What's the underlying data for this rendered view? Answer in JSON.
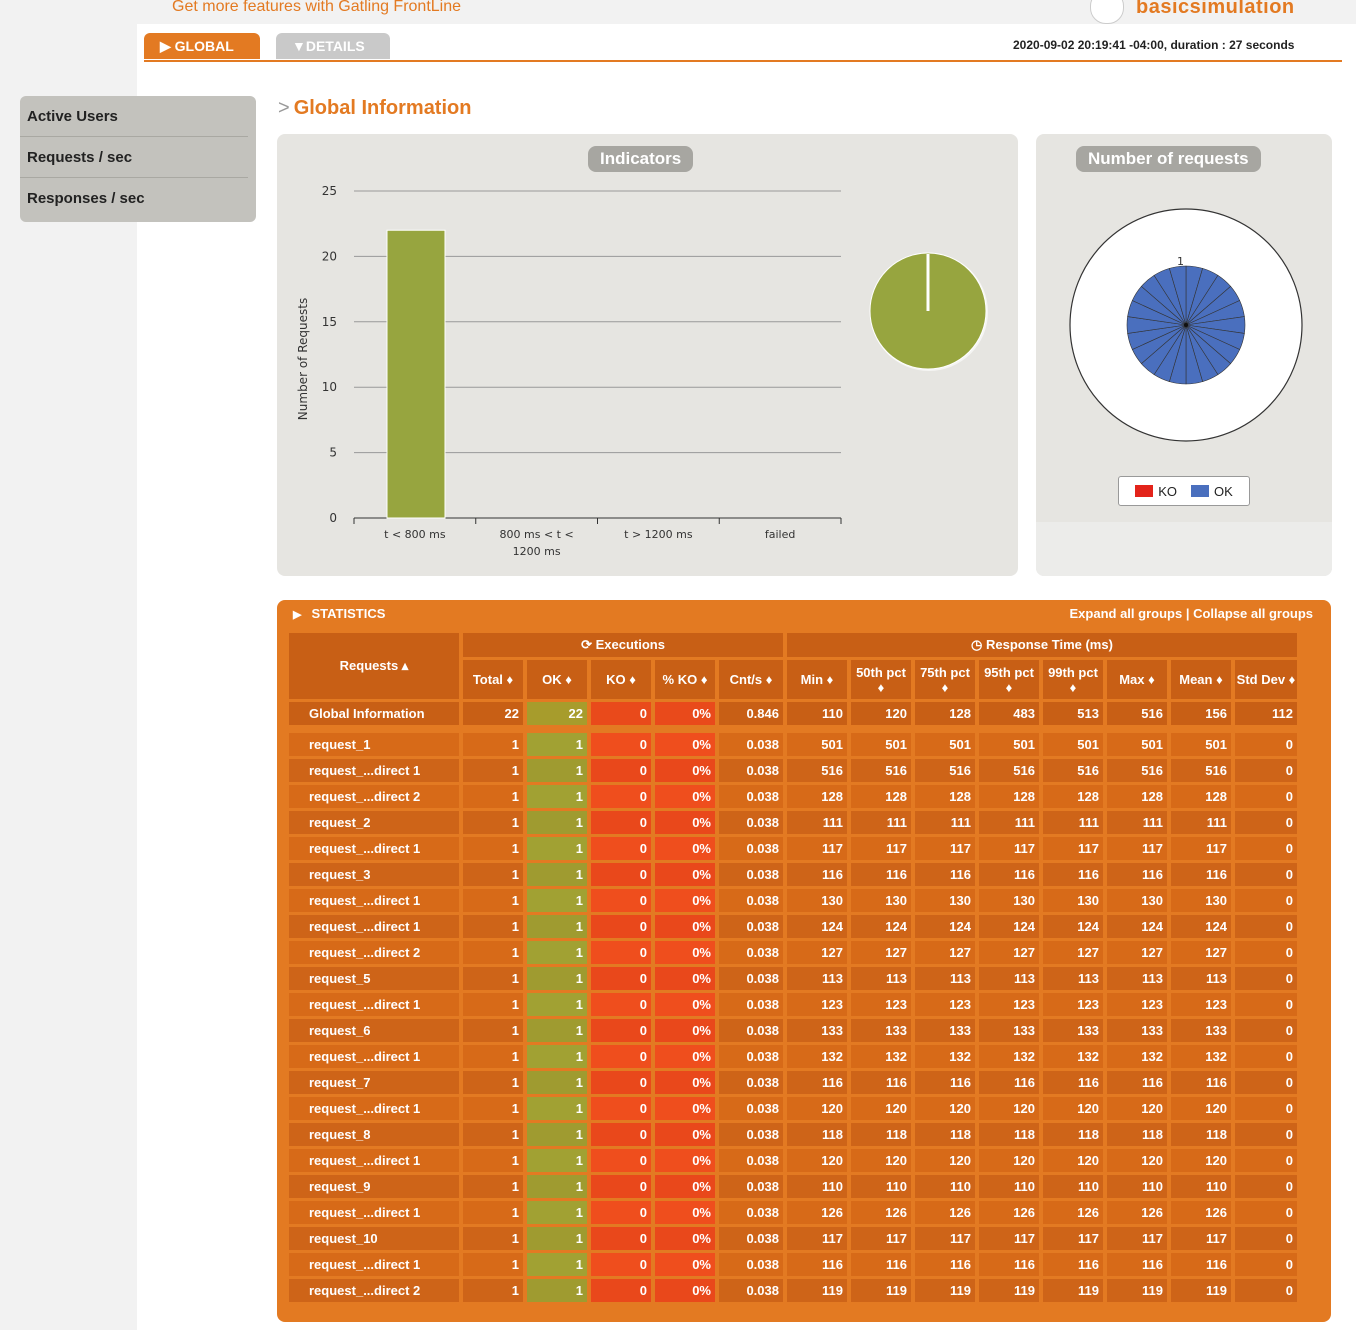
{
  "top": {
    "frontline_link": "Get more features with Gatling FrontLine",
    "simulation_name": "basicsimulation"
  },
  "tabs": {
    "global": "GLOBAL",
    "details": "DETAILS"
  },
  "run_info": "2020-09-02 20:19:41 -04:00, duration : 27 seconds",
  "sidebar": {
    "items": [
      {
        "label": "Active Users"
      },
      {
        "label": "Requests / sec"
      },
      {
        "label": "Responses / sec"
      }
    ]
  },
  "page_title": "Global Information",
  "chart_data": [
    {
      "type": "bar",
      "title": "Indicators",
      "ylabel": "Number of Requests",
      "categories": [
        "t < 800 ms",
        "800 ms < t < 1200 ms",
        "t > 1200 ms",
        "failed"
      ],
      "values": [
        22,
        0,
        0,
        0
      ],
      "ylim": [
        0,
        25
      ],
      "yticks": [
        0,
        5,
        10,
        15,
        20,
        25
      ],
      "color": "#97a53f"
    },
    {
      "type": "pie",
      "labels": [
        "t < 800 ms",
        "800 ms < t < 1200 ms",
        "t > 1200 ms",
        "failed"
      ],
      "values": [
        22,
        0,
        0,
        0
      ],
      "color": "#97a53f"
    },
    {
      "type": "pie",
      "title": "Number of requests",
      "slices": 22,
      "value_label": "1",
      "legend": [
        {
          "name": "KO",
          "color": "#e3231a"
        },
        {
          "name": "OK",
          "color": "#4a6fbe"
        }
      ]
    }
  ],
  "stats": {
    "title": "STATISTICS",
    "expand": "Expand all groups",
    "collapse": "Collapse all groups",
    "executions_label": "Executions",
    "response_time_label": "Response Time (ms)",
    "headers": [
      "Requests ▴",
      "Total ♦",
      "OK ♦",
      "KO ♦",
      "% KO ♦",
      "Cnt/s ♦",
      "Min ♦",
      "50th pct ♦",
      "75th pct ♦",
      "95th pct ♦",
      "99th pct ♦",
      "Max ♦",
      "Mean ♦",
      "Std Dev ♦"
    ],
    "global": [
      "Global Information",
      "22",
      "22",
      "0",
      "0%",
      "0.846",
      "110",
      "120",
      "128",
      "483",
      "513",
      "516",
      "156",
      "112"
    ],
    "rows": [
      [
        "request_1",
        "1",
        "1",
        "0",
        "0%",
        "0.038",
        "501",
        "501",
        "501",
        "501",
        "501",
        "501",
        "501",
        "0"
      ],
      [
        "request_...direct 1",
        "1",
        "1",
        "0",
        "0%",
        "0.038",
        "516",
        "516",
        "516",
        "516",
        "516",
        "516",
        "516",
        "0"
      ],
      [
        "request_...direct 2",
        "1",
        "1",
        "0",
        "0%",
        "0.038",
        "128",
        "128",
        "128",
        "128",
        "128",
        "128",
        "128",
        "0"
      ],
      [
        "request_2",
        "1",
        "1",
        "0",
        "0%",
        "0.038",
        "111",
        "111",
        "111",
        "111",
        "111",
        "111",
        "111",
        "0"
      ],
      [
        "request_...direct 1",
        "1",
        "1",
        "0",
        "0%",
        "0.038",
        "117",
        "117",
        "117",
        "117",
        "117",
        "117",
        "117",
        "0"
      ],
      [
        "request_3",
        "1",
        "1",
        "0",
        "0%",
        "0.038",
        "116",
        "116",
        "116",
        "116",
        "116",
        "116",
        "116",
        "0"
      ],
      [
        "request_...direct 1",
        "1",
        "1",
        "0",
        "0%",
        "0.038",
        "130",
        "130",
        "130",
        "130",
        "130",
        "130",
        "130",
        "0"
      ],
      [
        "request_...direct 1",
        "1",
        "1",
        "0",
        "0%",
        "0.038",
        "124",
        "124",
        "124",
        "124",
        "124",
        "124",
        "124",
        "0"
      ],
      [
        "request_...direct 2",
        "1",
        "1",
        "0",
        "0%",
        "0.038",
        "127",
        "127",
        "127",
        "127",
        "127",
        "127",
        "127",
        "0"
      ],
      [
        "request_5",
        "1",
        "1",
        "0",
        "0%",
        "0.038",
        "113",
        "113",
        "113",
        "113",
        "113",
        "113",
        "113",
        "0"
      ],
      [
        "request_...direct 1",
        "1",
        "1",
        "0",
        "0%",
        "0.038",
        "123",
        "123",
        "123",
        "123",
        "123",
        "123",
        "123",
        "0"
      ],
      [
        "request_6",
        "1",
        "1",
        "0",
        "0%",
        "0.038",
        "133",
        "133",
        "133",
        "133",
        "133",
        "133",
        "133",
        "0"
      ],
      [
        "request_...direct 1",
        "1",
        "1",
        "0",
        "0%",
        "0.038",
        "132",
        "132",
        "132",
        "132",
        "132",
        "132",
        "132",
        "0"
      ],
      [
        "request_7",
        "1",
        "1",
        "0",
        "0%",
        "0.038",
        "116",
        "116",
        "116",
        "116",
        "116",
        "116",
        "116",
        "0"
      ],
      [
        "request_...direct 1",
        "1",
        "1",
        "0",
        "0%",
        "0.038",
        "120",
        "120",
        "120",
        "120",
        "120",
        "120",
        "120",
        "0"
      ],
      [
        "request_8",
        "1",
        "1",
        "0",
        "0%",
        "0.038",
        "118",
        "118",
        "118",
        "118",
        "118",
        "118",
        "118",
        "0"
      ],
      [
        "request_...direct 1",
        "1",
        "1",
        "0",
        "0%",
        "0.038",
        "120",
        "120",
        "120",
        "120",
        "120",
        "120",
        "120",
        "0"
      ],
      [
        "request_9",
        "1",
        "1",
        "0",
        "0%",
        "0.038",
        "110",
        "110",
        "110",
        "110",
        "110",
        "110",
        "110",
        "0"
      ],
      [
        "request_...direct 1",
        "1",
        "1",
        "0",
        "0%",
        "0.038",
        "126",
        "126",
        "126",
        "126",
        "126",
        "126",
        "126",
        "0"
      ],
      [
        "request_10",
        "1",
        "1",
        "0",
        "0%",
        "0.038",
        "117",
        "117",
        "117",
        "117",
        "117",
        "117",
        "117",
        "0"
      ],
      [
        "request_...direct 1",
        "1",
        "1",
        "0",
        "0%",
        "0.038",
        "116",
        "116",
        "116",
        "116",
        "116",
        "116",
        "116",
        "0"
      ],
      [
        "request_...direct 2",
        "1",
        "1",
        "0",
        "0%",
        "0.038",
        "119",
        "119",
        "119",
        "119",
        "119",
        "119",
        "119",
        "0"
      ]
    ]
  }
}
